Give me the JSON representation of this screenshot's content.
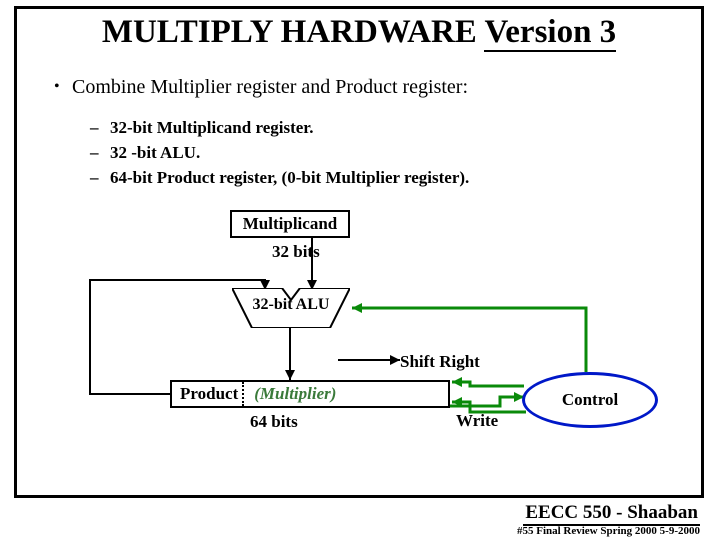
{
  "title_parts": {
    "a": "MULTIPLY HARDWARE ",
    "b": "Version 3"
  },
  "bullet": "Combine Multiplier register and Product register:",
  "subs": {
    "a": "32-bit Multiplicand register.",
    "b": "32 -bit ALU.",
    "c": "64-bit Product register,  (0-bit Multiplier register)."
  },
  "boxes": {
    "multiplicand": "Multiplicand",
    "bits32": "32 bits",
    "alu": "32-bit ALU",
    "product": "Product",
    "multiplier": "(Multiplier)",
    "bits64": "64 bits",
    "shiftright": "Shift Right",
    "write": "Write",
    "control": "Control"
  },
  "footer": {
    "course": "EECC 550 - Shaaban",
    "meta": "#55   Final Review    Spring 2000   5-9-2000"
  }
}
